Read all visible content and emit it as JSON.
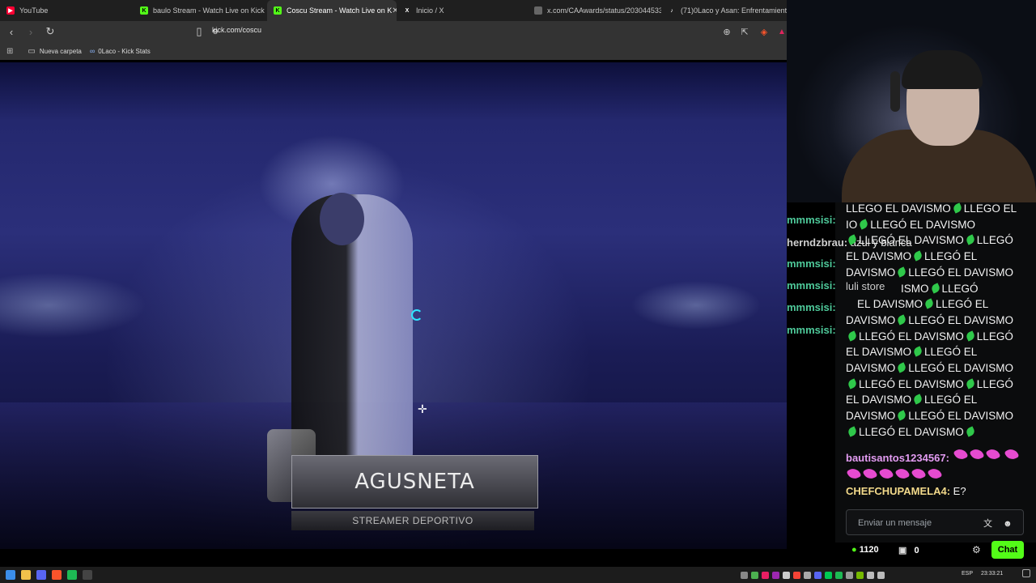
{
  "browser": {
    "tabs": [
      {
        "label": "YouTube",
        "icon": "youtube-icon",
        "color": "#ff0033"
      },
      {
        "label": "baulo Stream - Watch Live on Kick",
        "icon": "kick-icon",
        "color": "#53fc18"
      },
      {
        "label": "Coscu Stream - Watch Live on K",
        "icon": "kick-icon",
        "color": "#53fc18",
        "active": true
      },
      {
        "label": "Inicio / X",
        "icon": "x-icon",
        "color": "#ffffff"
      },
      {
        "label": "x.com/CAAwards/status/2030445338",
        "icon": "globe-icon",
        "color": "#888888"
      },
      {
        "label": "(71)0Laco y Asan: Enfrentamiento e",
        "icon": "tiktok-icon",
        "color": "#ffffff"
      }
    ],
    "url": "kick.com/coscu",
    "bookmarks": [
      {
        "label": "Nueva carpeta",
        "icon": "folder-icon"
      },
      {
        "label": "0Laco - Kick Stats",
        "icon": "stats-icon"
      }
    ]
  },
  "video": {
    "lower_third_name": "AGUSNETA",
    "lower_third_subtitle": "STREAMER DEPORTIVO"
  },
  "chat": {
    "side_users": [
      "mmmsisi:",
      "mmmsisi:",
      "mmmsisi:",
      "mmmsisi:"
    ],
    "side_message": {
      "user": "herndzbrau:",
      "text": "azul y blanca"
    },
    "side_partial": "luli store",
    "spam_lines": [
      "LLEGO EL DAVISMO",
      "LLEGO EL",
      "IO",
      "LLEGÓ EL DAVISMO",
      "LLEGÓ EL DAVISMO",
      "LLEGÓ",
      "EL DAVISMO",
      "LLEGÓ EL",
      "DAVISMO",
      "LLEGÓ EL DAVISMO",
      "ISMO",
      "LLEGÓ",
      "EL DAVISMO",
      "LLEGÓ EL",
      "DAVISMO",
      "LLEGÓ EL DAVISMO",
      "LLEGÓ EL DAVISMO",
      "LLEGÓ",
      "EL DAVISMO",
      "LLEGÓ EL",
      "DAVISMO",
      "LLEGÓ EL DAVISMO",
      "LLEGÓ EL DAVISMO",
      "LLEGÓ",
      "EL DAVISMO",
      "LLEGÓ EL",
      "DAVISMO",
      "LLEGÓ EL DAVISMO",
      "LLEGÓ EL DAVISMO"
    ],
    "messages": [
      {
        "user": "bautisantos1234567:",
        "text": "",
        "color": "#e39cf2"
      },
      {
        "user": "CHEFCHUPAMELA4:",
        "text": "E?",
        "color": "#f2d98a"
      }
    ],
    "input_placeholder": "Enviar un mensaje",
    "kicks_count": "1120",
    "drops_count": "0",
    "chat_button": "Chat",
    "accent": "#53fc18"
  },
  "taskbar": {
    "lang": "ESP",
    "clock": "23:33:21"
  }
}
